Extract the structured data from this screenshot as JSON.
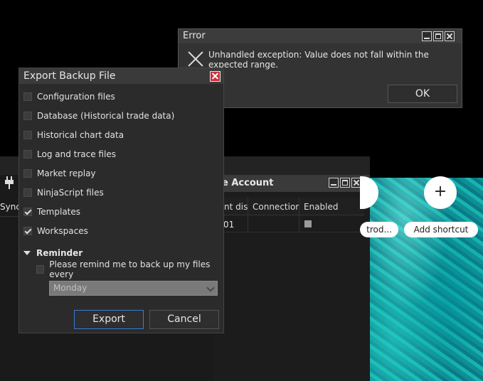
{
  "error_dialog": {
    "title": "Error",
    "message": "Unhandled exception: Value does not fall within the expected range.",
    "ok_label": "OK"
  },
  "export_dialog": {
    "title": "Export Backup File",
    "items": [
      {
        "label": "Configuration files",
        "checked": false
      },
      {
        "label": "Database (Historical trade data)",
        "checked": false
      },
      {
        "label": "Historical chart data",
        "checked": false
      },
      {
        "label": "Log and trace files",
        "checked": false
      },
      {
        "label": "Market replay",
        "checked": false
      },
      {
        "label": "NinjaScript files",
        "checked": false
      },
      {
        "label": "Templates",
        "checked": true
      },
      {
        "label": "Workspaces",
        "checked": true
      }
    ],
    "reminder_heading": "Reminder",
    "reminder_text": "Please remind me to back up my files every",
    "day_select": "Monday",
    "export_label": "Export",
    "cancel_label": "Cancel"
  },
  "account_window": {
    "title_fragment": "e Account",
    "columns": [
      "nt dis",
      "Connectior",
      "Enabled"
    ],
    "left_column": "Sync",
    "cell_fragment": "01"
  },
  "shortcuts": {
    "plus": "+",
    "introduction_fragment": "trod...",
    "add_shortcut": "Add shortcut"
  }
}
